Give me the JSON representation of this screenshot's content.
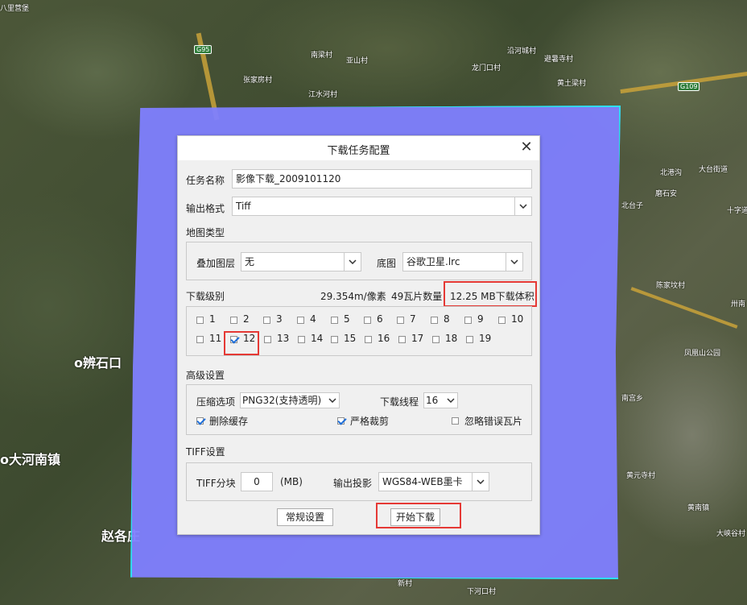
{
  "map": {
    "places": [
      "八里营堡",
      "G95",
      "南梁村",
      "张家房村",
      "亚山村",
      "江水河村",
      "龙门口村",
      "沿河城村",
      "避暑寺村",
      "黄土梁村",
      "G109",
      "北港沟",
      "大台街道",
      "磨石安",
      "北台子",
      "十字道",
      "陈家坟村",
      "卅南",
      "凤凰山公园",
      "南宫乡",
      "黄元寺村",
      "黄南镇",
      "大峡谷村",
      "新村",
      "下河口村",
      "o辨石口",
      "o大河南镇",
      "赵各庄"
    ]
  },
  "dialog": {
    "title": "下载任务配置",
    "task_name_label": "任务名称",
    "task_name_value": "影像下载_2009101120",
    "output_format_label": "输出格式",
    "output_format_value": "Tiff",
    "map_type_section": "地图类型",
    "overlay_layer_label": "叠加图层",
    "overlay_layer_value": "无",
    "base_map_label": "底图",
    "base_map_value": "谷歌卫星.lrc",
    "download_level_section": "下载级别",
    "resolution_text": "29.354m/像素",
    "tile_count_text": "49瓦片数量",
    "download_size_text": "12.25 MB下载体积",
    "levels": [
      {
        "label": "1",
        "checked": false
      },
      {
        "label": "2",
        "checked": false
      },
      {
        "label": "3",
        "checked": false
      },
      {
        "label": "4",
        "checked": false
      },
      {
        "label": "5",
        "checked": false
      },
      {
        "label": "6",
        "checked": false
      },
      {
        "label": "7",
        "checked": false
      },
      {
        "label": "8",
        "checked": false
      },
      {
        "label": "9",
        "checked": false
      },
      {
        "label": "10",
        "checked": false
      },
      {
        "label": "11",
        "checked": false
      },
      {
        "label": "12",
        "checked": true
      },
      {
        "label": "13",
        "checked": false
      },
      {
        "label": "14",
        "checked": false
      },
      {
        "label": "15",
        "checked": false
      },
      {
        "label": "16",
        "checked": false
      },
      {
        "label": "17",
        "checked": false
      },
      {
        "label": "18",
        "checked": false
      },
      {
        "label": "19",
        "checked": false
      }
    ],
    "advanced_section": "高级设置",
    "compression_label": "压缩选项",
    "compression_value": "PNG32(支持透明)",
    "threads_label": "下载线程",
    "threads_value": "16",
    "delete_cache_label": "删除缓存",
    "delete_cache_checked": true,
    "strict_crop_label": "严格裁剪",
    "strict_crop_checked": true,
    "ignore_error_label": "忽略错误瓦片",
    "ignore_error_checked": false,
    "tiff_section": "TIFF设置",
    "tiff_split_label": "TIFF分块",
    "tiff_split_value": "0",
    "tiff_split_unit": "(MB)",
    "projection_label": "输出投影",
    "projection_value": "WGS84-WEB墨卡托",
    "general_settings_button": "常规设置",
    "start_download_button": "开始下载"
  },
  "colors": {
    "region_fill": "#8080ff",
    "region_border": "#2de0ef",
    "highlight_box": "#e53935",
    "check_color": "#1e6ed8"
  }
}
